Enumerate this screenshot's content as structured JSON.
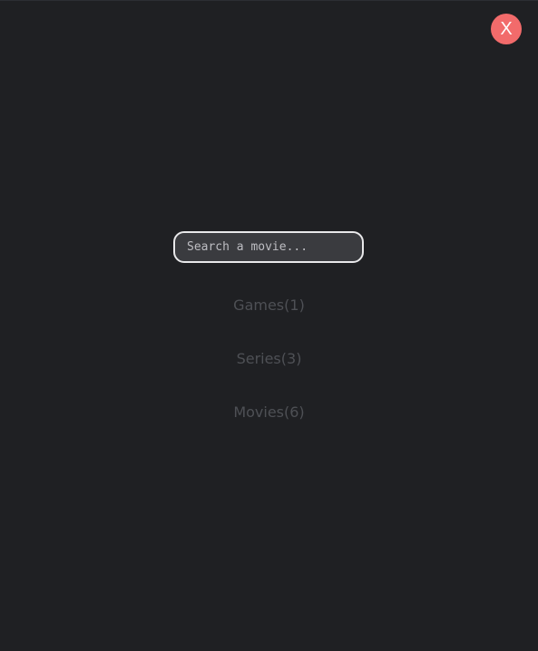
{
  "close_button": {
    "label": "X",
    "color": "#f26b6b"
  },
  "search": {
    "placeholder": "Search a movie...",
    "value": ""
  },
  "categories": [
    {
      "label": "Games(1)"
    },
    {
      "label": "Series(3)"
    },
    {
      "label": "Movies(6)"
    }
  ],
  "colors": {
    "background": "#1f2023",
    "category_text": "#4e5055",
    "search_border": "#e8e8ea"
  }
}
